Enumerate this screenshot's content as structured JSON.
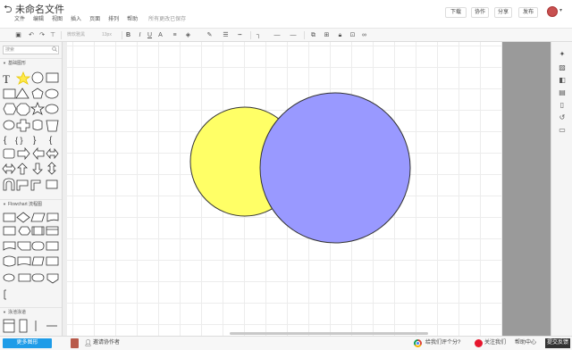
{
  "title_bar": {
    "document_title": "未命名文件",
    "menu": [
      "文件",
      "编辑",
      "视图",
      "插入",
      "页面",
      "排列",
      "帮助"
    ],
    "save_status": "所有更改已保存",
    "buttons": {
      "download": "下载",
      "collaborate": "协作",
      "share": "分享",
      "publish": "发布"
    }
  },
  "toolbar": {
    "font_family": "微软雅黑",
    "font_size": "13px",
    "bold": "B",
    "italic": "I",
    "underline": "U",
    "font_color": "A"
  },
  "sidebar": {
    "search_placeholder": "搜索",
    "sections": [
      {
        "label": "基础图形"
      },
      {
        "label": "Flowchart 流程图"
      },
      {
        "label": "泳池泳道"
      }
    ],
    "more_shapes_button": "更多图形"
  },
  "canvas": {
    "shapes": [
      {
        "type": "circle",
        "name": "yellow-circle",
        "fill": "#ffff66",
        "stroke": "#333333"
      },
      {
        "type": "circle",
        "name": "purple-circle",
        "fill": "#9999ff",
        "stroke": "#333333"
      }
    ]
  },
  "right_panel": {
    "icons": [
      "compass-icon",
      "image-icon",
      "layers-icon",
      "pages-icon",
      "page-icon",
      "history-icon",
      "comment-icon"
    ]
  },
  "bottom_bar": {
    "invite_collaborators": "邀请协作者",
    "rate_us": "给我们评个分?",
    "follow_us": "关注我们",
    "help_center": "帮助中心",
    "feedback": "提交反馈"
  },
  "colors": {
    "accent_blue": "#1e9ce8",
    "yellow_fill": "#ffff66",
    "purple_fill": "#9999ff"
  }
}
